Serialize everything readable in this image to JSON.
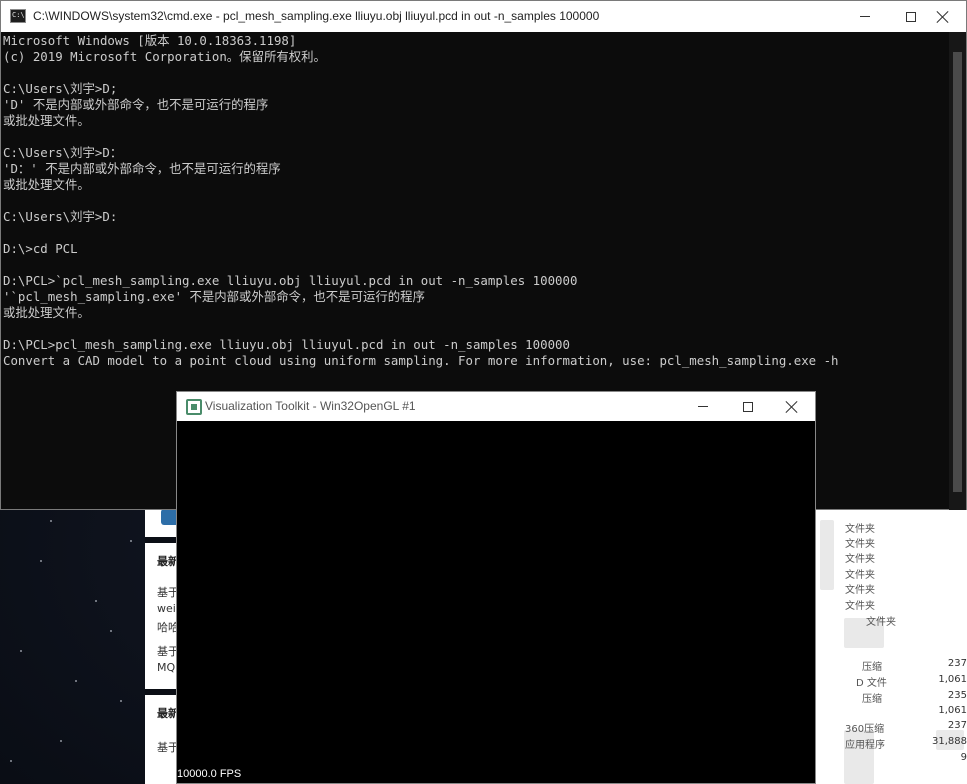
{
  "cmd": {
    "title": "C:\\WINDOWS\\system32\\cmd.exe - pcl_mesh_sampling.exe  lliuyu.obj lliuyul.pcd in out -n_samples 100000",
    "lines": [
      "Microsoft Windows [版本 10.0.18363.1198]",
      "(c) 2019 Microsoft Corporation。保留所有权利。",
      "",
      "C:\\Users\\刘宇>D;",
      "'D' 不是内部或外部命令，也不是可运行的程序",
      "或批处理文件。",
      "",
      "C:\\Users\\刘宇>D：",
      "'D：' 不是内部或外部命令，也不是可运行的程序",
      "或批处理文件。",
      "",
      "C:\\Users\\刘宇>D:",
      "",
      "D:\\>cd PCL",
      "",
      "D:\\PCL>`pcl_mesh_sampling.exe lliuyu.obj lliuyul.pcd in out -n_samples 100000",
      "'`pcl_mesh_sampling.exe' 不是内部或外部命令，也不是可运行的程序",
      "或批处理文件。",
      "",
      "D:\\PCL>pcl_mesh_sampling.exe lliuyu.obj lliuyul.pcd in out -n_samples 100000",
      "Convert a CAD model to a point cloud using uniform sampling. For more information, use: pcl_mesh_sampling.exe -h"
    ]
  },
  "vtk": {
    "title": "Visualization Toolkit - Win32OpenGL #1",
    "fps": "10000.0 FPS"
  },
  "blog": {
    "items": [
      "最新",
      "基于",
      "wei",
      "哈哈",
      "基于",
      "MQ",
      "最新",
      "基于"
    ]
  },
  "explorer": {
    "types": [
      "文件夹",
      "文件夹",
      "文件夹",
      "文件夹",
      "文件夹",
      "文件夹",
      "文件夹",
      "压缩",
      "D 文件",
      "压缩",
      "360压缩",
      "应用程序"
    ],
    "sizes": [
      "237",
      "1,061",
      "235",
      "1,061",
      "237",
      "31,888",
      "9"
    ]
  },
  "icons": {
    "cmd": "cmd-app-icon",
    "vtk": "vtk-app-icon",
    "minimize": "minimize-icon",
    "maximize": "maximize-icon",
    "close": "close-icon"
  }
}
